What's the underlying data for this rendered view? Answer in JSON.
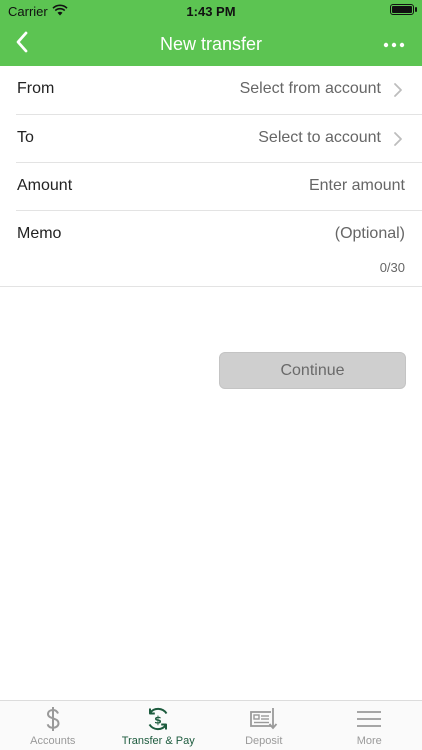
{
  "status": {
    "carrier": "Carrier",
    "time": "1:43 PM"
  },
  "nav": {
    "title": "New transfer"
  },
  "form": {
    "from": {
      "label": "From",
      "placeholder": "Select from account"
    },
    "to": {
      "label": "To",
      "placeholder": "Select to account"
    },
    "amount": {
      "label": "Amount",
      "placeholder": "Enter amount"
    },
    "memo": {
      "label": "Memo",
      "placeholder": "(Optional)",
      "counter": "0/30"
    }
  },
  "actions": {
    "continue_label": "Continue"
  },
  "tabs": [
    {
      "label": "Accounts",
      "icon": "dollar-icon",
      "active": false
    },
    {
      "label": "Transfer & Pay",
      "icon": "transfer-pay-icon",
      "active": true
    },
    {
      "label": "Deposit",
      "icon": "deposit-check-icon",
      "active": false
    },
    {
      "label": "More",
      "icon": "menu-icon",
      "active": false
    }
  ],
  "colors": {
    "brand_green": "#5cc452",
    "active_tab": "#1d5b3e",
    "disabled_button": "#cfcfcf"
  }
}
